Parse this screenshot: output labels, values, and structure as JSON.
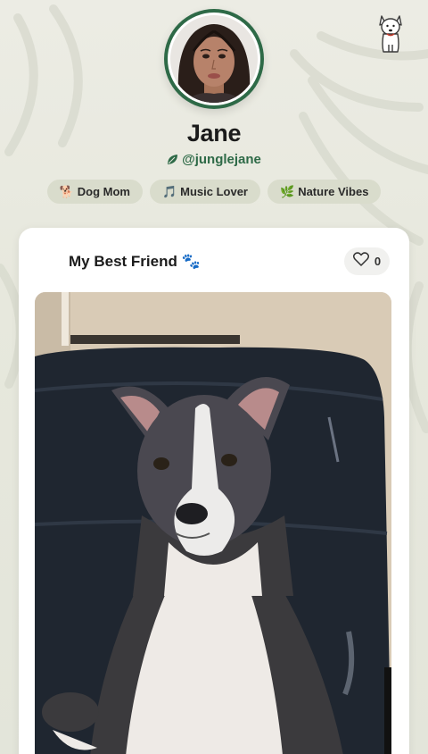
{
  "profile": {
    "name": "Jane",
    "handle": "@junglejane"
  },
  "tags": [
    {
      "emoji": "🐕",
      "label": "Dog Mom"
    },
    {
      "emoji": "🎵",
      "label": "Music Lover"
    },
    {
      "emoji": "🌿",
      "label": "Nature Vibes"
    }
  ],
  "post": {
    "title": "My Best Friend 🐾",
    "likes": "0"
  },
  "colors": {
    "accent": "#2e6a47",
    "background": "#e7e8dd",
    "tag_bg": "#d9dccc",
    "card_bg": "#ffffff"
  },
  "icons": {
    "logo": "dog-logo-icon",
    "handle": "leaf-icon",
    "like": "heart-icon"
  }
}
